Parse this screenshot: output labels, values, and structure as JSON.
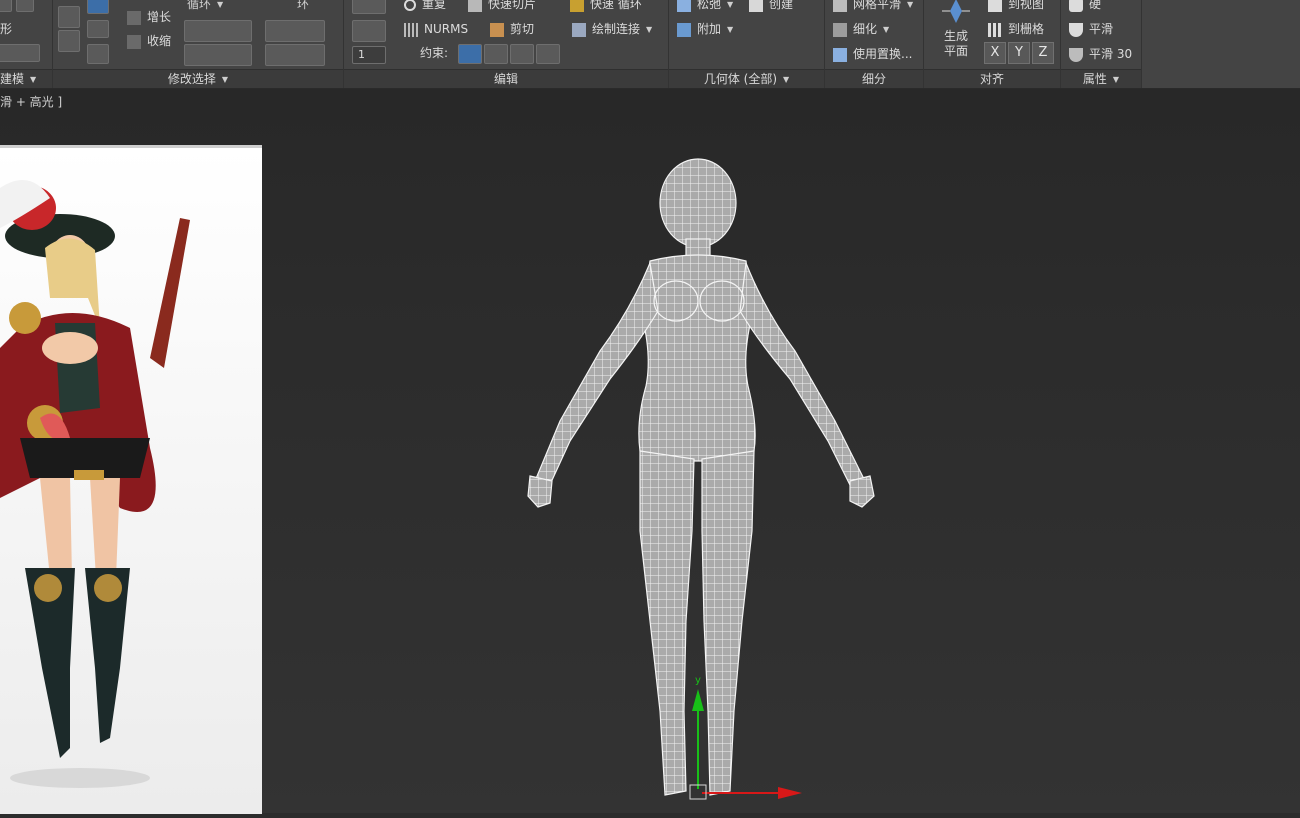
{
  "ribbon": {
    "panel_modeling": {
      "footer": "建模",
      "label_shape": "形"
    },
    "panel_modify_selection": {
      "footer": "修改选择",
      "grow": "增长",
      "shrink": "收缩",
      "loop": "循环",
      "ring": "环"
    },
    "panel_edit": {
      "footer": "编辑",
      "repeat": "重复",
      "quickslice": "快速切片",
      "quickloop": "快速 循环",
      "nurms": "NURMS",
      "cut": "剪切",
      "paint_connect": "绘制连接",
      "constraints": "约束:",
      "spinner_value": "1"
    },
    "panel_geometry": {
      "footer": "几何体 (全部)",
      "relax": "松弛",
      "create": "创建",
      "attach": "附加"
    },
    "panel_subdivision": {
      "footer": "细分",
      "meshsmooth": "网格平滑",
      "tessellate": "细化",
      "use_displace": "使用置换..."
    },
    "panel_align": {
      "footer": "对齐",
      "make_planar": "生成平面",
      "to_view": "到视图",
      "to_grid": "到栅格",
      "x": "X",
      "y": "Y",
      "z": "Z"
    },
    "panel_properties": {
      "footer": "属性",
      "hard": "硬",
      "smooth": "平滑",
      "smooth30": "平滑 30"
    }
  },
  "viewport": {
    "label": "滑 + 高光 ]",
    "gizmo_y_label": "y"
  },
  "colors": {
    "ribbon_bg": "#444444",
    "viewport_bg": "#2c2c2c",
    "gizmo_y": "#18c018",
    "gizmo_x": "#d81818"
  }
}
